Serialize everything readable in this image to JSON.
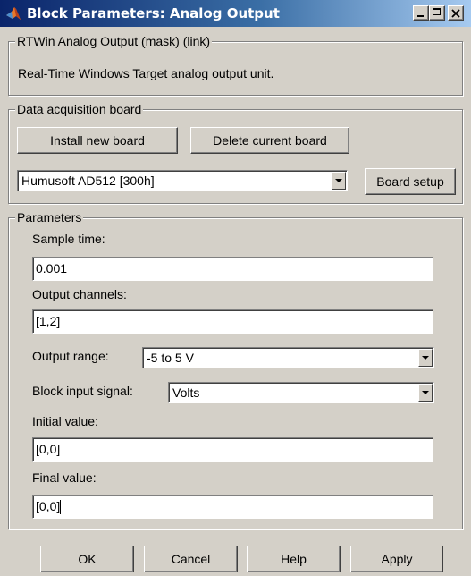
{
  "window": {
    "title": "Block Parameters: Analog Output",
    "icon": "matlab-icon",
    "controls": [
      "minimize-icon",
      "maximize-icon",
      "close-icon"
    ]
  },
  "description_group": {
    "legend": "RTWin Analog Output (mask) (link)",
    "text": "Real-Time Windows Target analog output unit."
  },
  "board_group": {
    "legend": "Data acquisition board",
    "install_button": "Install new board",
    "delete_button": "Delete current board",
    "board_select": "Humusoft AD512 [300h]",
    "setup_button": "Board setup"
  },
  "parameters": {
    "legend": "Parameters",
    "sample_time_label": "Sample time:",
    "sample_time_value": "0.001",
    "output_channels_label": "Output channels:",
    "output_channels_value": "[1,2]",
    "output_range_label": "Output range:",
    "output_range_value": "-5 to 5 V",
    "input_signal_label": "Block input signal:",
    "input_signal_value": "Volts",
    "initial_value_label": "Initial value:",
    "initial_value_value": "[0,0]",
    "final_value_label": "Final value:",
    "final_value_value": "[0,0]"
  },
  "footer": {
    "ok": "OK",
    "cancel": "Cancel",
    "help": "Help",
    "apply": "Apply"
  }
}
